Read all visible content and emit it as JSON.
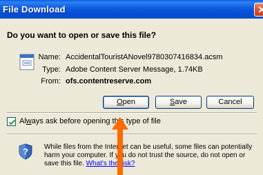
{
  "window": {
    "title": "File Download",
    "close_glyph": "✕"
  },
  "dialog": {
    "question": "Do you want to open or save this file?",
    "file_icon": "document-icon",
    "fields": {
      "name_label": "Name:",
      "name_value": "AccidentalTouristANovel9780307416834.acsm",
      "type_label": "Type:",
      "type_value": "Adobe Content Server Message, 1.74KB",
      "from_label": "From:",
      "from_value": "ofs.contentreserve.com"
    },
    "buttons": {
      "open_key": "O",
      "open_rest": "pen",
      "save_key": "S",
      "save_rest": "ave",
      "cancel": "Cancel"
    },
    "checkbox": {
      "checked": true,
      "label_pre": "Al",
      "label_key": "w",
      "label_post": "ays ask before opening this type of file"
    },
    "warning": {
      "icon": "shield-question-icon",
      "text": "While files from the Internet can be useful, some files can potentially harm your computer. If you do not trust the source, do not open or save this file.",
      "link": "What's the risk?"
    },
    "annotation": {
      "arrow_color": "#ff6a00"
    }
  }
}
